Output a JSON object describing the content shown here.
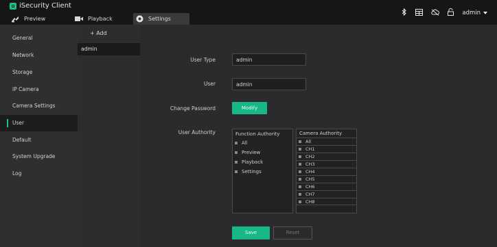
{
  "app": {
    "title": "iSecurity Client"
  },
  "tabs": [
    {
      "label": "Preview"
    },
    {
      "label": "Playback"
    },
    {
      "label": "Settings"
    }
  ],
  "topright": {
    "username": "admin"
  },
  "sidebar": {
    "items": [
      {
        "label": "General"
      },
      {
        "label": "Network"
      },
      {
        "label": "Storage"
      },
      {
        "label": "IP Camera"
      },
      {
        "label": "Camera Settings"
      },
      {
        "label": "User"
      },
      {
        "label": "Default"
      },
      {
        "label": "System Upgrade"
      },
      {
        "label": "Log"
      }
    ],
    "active_index": 5
  },
  "userlist": {
    "add_label": "+ Add",
    "users": [
      "admin"
    ]
  },
  "form": {
    "user_type_label": "User Type",
    "user_type_value": "admin",
    "user_label": "User",
    "user_value": "admin",
    "change_password_label": "Change Password",
    "modify_label": "Modify",
    "user_authority_label": "User Authority",
    "function_authority": {
      "header": "Function Authority",
      "items": [
        "All",
        "Preview",
        "Playback",
        "Settings"
      ]
    },
    "camera_authority": {
      "header": "Camera Authority",
      "items": [
        "All",
        "CH1",
        "CH2",
        "CH3",
        "CH4",
        "CH5",
        "CH6",
        "CH7",
        "CH8"
      ]
    },
    "save_label": "Save",
    "reset_label": "Reset"
  },
  "colors": {
    "accent": "#17b885",
    "topbar": "#161617",
    "sidebar": "#2f2f31",
    "main": "#2b2b2d"
  }
}
